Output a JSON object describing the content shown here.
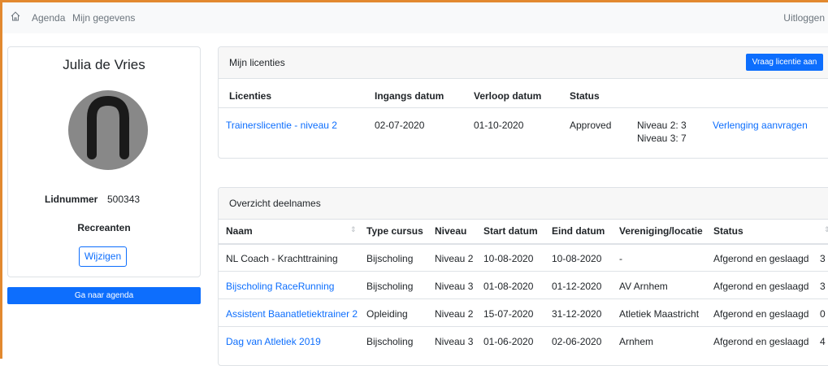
{
  "nav": {
    "agenda": "Agenda",
    "gegevens": "Mijn gegevens",
    "logout": "Uitloggen"
  },
  "profile": {
    "name": "Julia de Vries",
    "lid_label": "Lidnummer",
    "lid_value": "500343",
    "group": "Recreanten",
    "edit_label": "Wijzigen",
    "agenda_button": "Ga naar agenda"
  },
  "licenties": {
    "title": "Mijn licenties",
    "request_button": "Vraag licentie aan",
    "headers": [
      "Licenties",
      "Ingangs datum",
      "Verloop datum",
      "Status"
    ],
    "row": {
      "name": "Trainerslicentie - niveau 2",
      "start": "02-07-2020",
      "end": "01-10-2020",
      "status": "Approved",
      "niveau_2": "Niveau 2: 3",
      "niveau_3": "Niveau 3: 7",
      "action": "Verlenging aanvragen"
    }
  },
  "deelnames": {
    "title": "Overzicht deelnames",
    "headers": [
      "Naam",
      "Type cursus",
      "Niveau",
      "Start datum",
      "Eind datum",
      "Vereniging/locatie",
      "Status"
    ],
    "rows": [
      {
        "naam": "NL Coach - Krachttraining",
        "link": false,
        "type": "Bijscholing",
        "niveau": "Niveau 2",
        "start": "10-08-2020",
        "eind": "10-08-2020",
        "locatie": "-",
        "status": "Afgerond en geslaagd",
        "extra": "3"
      },
      {
        "naam": "Bijscholing RaceRunning",
        "link": true,
        "type": "Bijscholing",
        "niveau": "Niveau 3",
        "start": "01-08-2020",
        "eind": "01-12-2020",
        "locatie": "AV Arnhem",
        "status": "Afgerond en geslaagd",
        "extra": "3"
      },
      {
        "naam": "Assistent Baanatletiektrainer 2",
        "link": true,
        "type": "Opleiding",
        "niveau": "Niveau 2",
        "start": "15-07-2020",
        "eind": "31-12-2020",
        "locatie": "Atletiek Maastricht",
        "status": "Afgerond en geslaagd",
        "extra": "0"
      },
      {
        "naam": "Dag van Atletiek 2019",
        "link": true,
        "type": "Bijscholing",
        "niveau": "Niveau 3",
        "start": "01-06-2020",
        "eind": "02-06-2020",
        "locatie": "Arnhem",
        "status": "Afgerond en geslaagd",
        "extra": "4"
      }
    ]
  },
  "colors": {
    "accent": "#0d6efd",
    "frame": "#e2892f"
  },
  "icons": [
    "home-icon",
    "avatar-icon",
    "sort-icon"
  ]
}
